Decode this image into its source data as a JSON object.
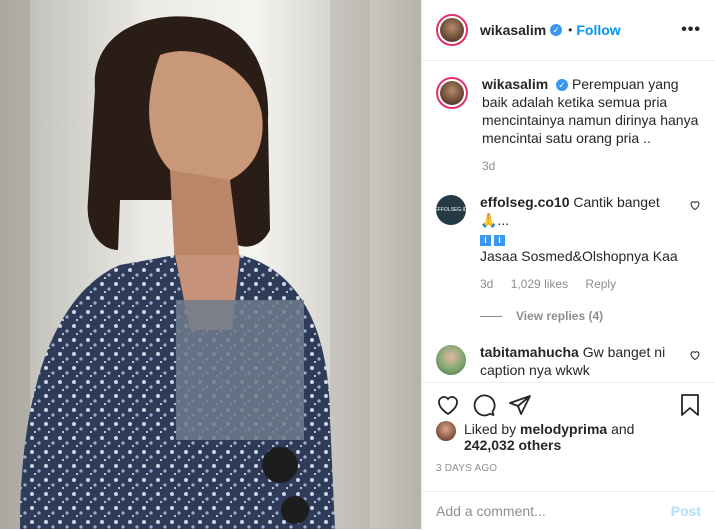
{
  "post": {
    "username": "wikasalim",
    "follow_label": "Follow",
    "more_label": "•••",
    "caption": "Perempuan yang baik adalah ketika semua pria mencintainya namun dirinya hanya mencintai satu orang pria ..",
    "caption_age": "3d"
  },
  "comments": [
    {
      "username": "effolseg.co10",
      "text_line1": "Cantik banget🙏...",
      "text_line2": "Jasaa Sosmed&Olshopnya Kaa",
      "avatar_text": "EFFOLSEG.ID",
      "age": "3d",
      "likes": "1,029 likes",
      "reply_label": "Reply",
      "view_replies": "View replies (4)"
    },
    {
      "username": "tabitamahucha",
      "text": "Gw banget ni caption nya wkwk"
    }
  ],
  "likes": {
    "prefix": "Liked by",
    "user": "melodyprima",
    "and": "and",
    "others": "242,032 others"
  },
  "time_ago": "3 DAYS AGO",
  "comment_box": {
    "placeholder": "Add a comment...",
    "post_label": "Post"
  },
  "icons": [
    "heart-icon",
    "comment-icon",
    "share-icon",
    "bookmark-icon",
    "verified-icon",
    "info-icon"
  ]
}
